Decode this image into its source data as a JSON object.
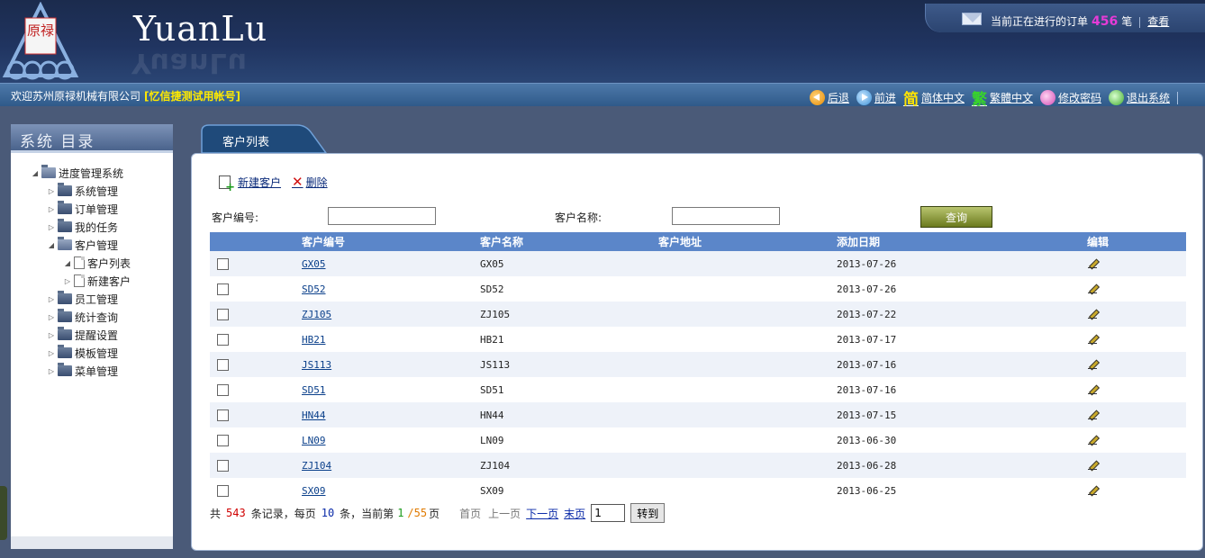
{
  "header": {
    "brand": "YuanLu",
    "brand_reflection": "YuanLu",
    "logo_text": "原禄",
    "order_notice_prefix": "当前正在进行的订单",
    "order_count": "456",
    "order_unit": "笔",
    "view_link": "查看"
  },
  "navbar": {
    "welcome": "欢迎苏州原禄机械有限公司",
    "account": "[忆信捷测试用帐号]",
    "actions": {
      "back": "后退",
      "forward": "前进",
      "simplified_glyph": "简",
      "simplified": "简体中文",
      "traditional_glyph": "繁",
      "traditional": "繁體中文",
      "change_password": "修改密码",
      "logout": "退出系统"
    }
  },
  "sidebar": {
    "title": "系统 目录",
    "root": "进度管理系统",
    "items": [
      "系统管理",
      "订单管理",
      "我的任务",
      "客户管理",
      "客户列表",
      "新建客户",
      "员工管理",
      "统计查询",
      "提醒设置",
      "模板管理",
      "菜单管理"
    ]
  },
  "tab": {
    "label": "客户列表"
  },
  "toolbar": {
    "new_customer": "新建客户",
    "delete": "删除"
  },
  "filters": {
    "code_label": "客户编号:",
    "code_value": "",
    "name_label": "客户名称:",
    "name_value": "",
    "query_button": "查询"
  },
  "table": {
    "headers": {
      "code": "客户编号",
      "name": "客户名称",
      "address": "客户地址",
      "date": "添加日期",
      "edit": "编辑"
    },
    "rows": [
      {
        "code": "GX05",
        "name": "GX05",
        "address": "",
        "date": "2013-07-26"
      },
      {
        "code": "SD52",
        "name": "SD52",
        "address": "",
        "date": "2013-07-26"
      },
      {
        "code": "ZJ105",
        "name": "ZJ105",
        "address": "",
        "date": "2013-07-22"
      },
      {
        "code": "HB21",
        "name": "HB21",
        "address": "",
        "date": "2013-07-17"
      },
      {
        "code": "JS113",
        "name": "JS113",
        "address": "",
        "date": "2013-07-16"
      },
      {
        "code": "SD51",
        "name": "SD51",
        "address": "",
        "date": "2013-07-16"
      },
      {
        "code": "HN44",
        "name": "HN44",
        "address": "",
        "date": "2013-07-15"
      },
      {
        "code": "LN09",
        "name": "LN09",
        "address": "",
        "date": "2013-06-30"
      },
      {
        "code": "ZJ104",
        "name": "ZJ104",
        "address": "",
        "date": "2013-06-28"
      },
      {
        "code": "SX09",
        "name": "SX09",
        "address": "",
        "date": "2013-06-25"
      }
    ]
  },
  "pager": {
    "t1": "共",
    "total": "543",
    "t2": "条记录，每页",
    "per_page": "10",
    "t3": "条，当前第",
    "current": "1",
    "slash_total": "/55",
    "t4": "页",
    "first": "首页",
    "prev": "上一页",
    "next": "下一页",
    "last": "末页",
    "goto_value": "1",
    "goto_button": "转到"
  }
}
